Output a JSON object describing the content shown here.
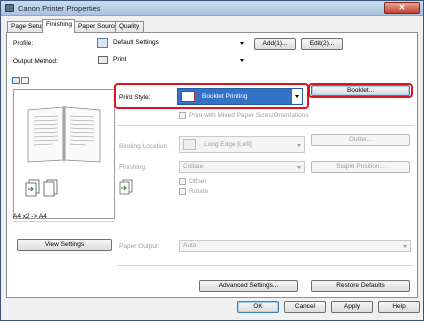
{
  "window": {
    "title": "Canon Printer Properties",
    "close_glyph": "✕"
  },
  "tabs": [
    "Page Setup",
    "Finishing",
    "Paper Source",
    "Quality"
  ],
  "profile": {
    "label": "Profile:",
    "value": "Default Settings",
    "add_label": "Add(1)...",
    "edit_label": "Edit(2)..."
  },
  "output_method": {
    "label": "Output Method:",
    "value": "Print"
  },
  "preview": {
    "caption": "A4 x2 -> A4",
    "view_settings_label": "View Settings"
  },
  "print_style": {
    "label": "Print Style:",
    "value": "Booklet Printing",
    "booklet_label": "Booklet...",
    "mixed_label": "Print with Mixed Paper Sizes/Orientations"
  },
  "binding": {
    "label": "Binding Location:",
    "value": "Long Edge [Left]",
    "gutter_label": "Gutter..."
  },
  "finishing": {
    "label": "Finishing:",
    "value": "Collate",
    "staple_label": "Staple Position...",
    "offset_label": "Offset",
    "rotate_label": "Rotate"
  },
  "paper_output": {
    "label": "Paper Output:",
    "value": "Auto"
  },
  "bottom": {
    "advanced_label": "Advanced Settings...",
    "restore_label": "Restore Defaults"
  },
  "footer": {
    "ok": "OK",
    "cancel": "Cancel",
    "apply": "Apply",
    "help": "Help"
  },
  "colors": {
    "highlight_red": "#e0141e",
    "selection_blue": "#3273c8"
  },
  "icons": [
    "printer-properties-icon",
    "default-settings-icon",
    "printer-icon",
    "booklet-icon",
    "page-layout-icon",
    "finishing-icon"
  ]
}
